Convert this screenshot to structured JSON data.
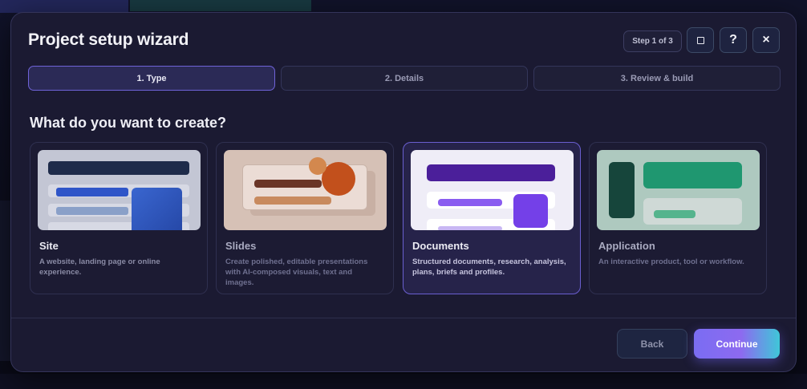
{
  "dialog": {
    "title": "Project setup wizard",
    "step_indicator": "Step 1 of 3",
    "buttons": {
      "maximize_icon": "square-icon",
      "help_glyph": "?",
      "close_glyph": "×"
    }
  },
  "stepper": {
    "steps": [
      {
        "label": "1. Type",
        "state": "active"
      },
      {
        "label": "2. Details",
        "state": "inactive"
      },
      {
        "label": "3. Review & build",
        "state": "inactive"
      }
    ]
  },
  "main": {
    "question": "What do you want to create?",
    "options": [
      {
        "title": "Site",
        "description": "A website, landing page or online experience.",
        "selected": false,
        "accent": "#2f55c8"
      },
      {
        "title": "Slides",
        "description": "Create polished, editable presentations with AI-composed visuals, text and images.",
        "selected": false,
        "accent": "#c2501c"
      },
      {
        "title": "Documents",
        "description": "Structured documents, research, analysis, plans, briefs and profiles.",
        "selected": true,
        "accent": "#7440e8"
      },
      {
        "title": "Application",
        "description": "An interactive product, tool or workflow.",
        "selected": false,
        "accent": "#1f9770"
      }
    ]
  },
  "footer": {
    "back_label": "Back",
    "continue_label": "Continue"
  },
  "colors": {
    "accent": "#7a6df2",
    "accent_end": "#3fc7d8",
    "dialog_bg": "#1b1a32"
  }
}
